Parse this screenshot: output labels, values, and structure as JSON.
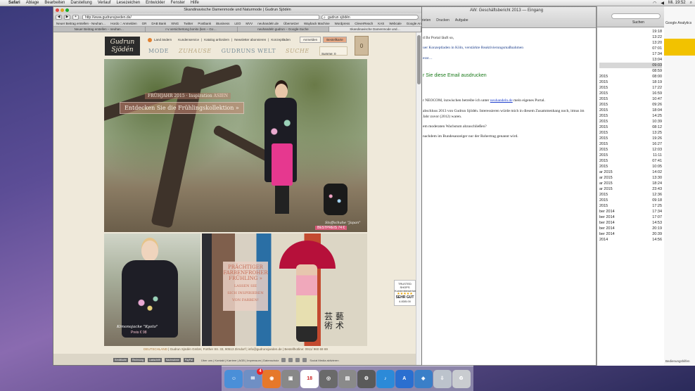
{
  "menubar": {
    "app": "Safari",
    "items": [
      "Ablage",
      "Bearbeiten",
      "Darstellung",
      "Verlauf",
      "Lesezeichen",
      "Entwickler",
      "Fenster",
      "Hilfe"
    ],
    "clock": "Mi. 19:52"
  },
  "mail": {
    "title": "AW: Geschäftsbericht 2013 — Eingang",
    "tools": [
      "Drucken",
      "Aufgabe"
    ],
    "tools_prefix": "erieten",
    "line1": "d Ihr Portal läuft so,",
    "line2": "uer Konzeptladen in Köln, verstärkte Reaktivierungsmaßnahmen",
    "line3": "erat…",
    "print_notice": "r Sie diese Email ausdrucken",
    "p1_pre": "r NEOCOM, inzwischen betreibe ich unter ",
    "p1_link": "neuhandeln.de",
    "p1_post": " mein eigenes Portal.",
    "p2": "abschluss 2013 von Gudrun Sjödén. Interessieren würde mich in diesem Zusammenhang noch, itmus im Jahr zuvor (2012) waren.",
    "p3": "em moderaten Wachstum abzuschließen?",
    "p4": "nachdem im Bundesanzeiger nur der Rohertrag genannt wird."
  },
  "list": {
    "search_label": "Suchen",
    "rows": [
      {
        "d": "",
        "t": "19:18"
      },
      {
        "d": "",
        "t": "13:22"
      },
      {
        "d": "",
        "t": "13:20"
      },
      {
        "d": "",
        "t": "07:01"
      },
      {
        "d": "",
        "t": "17:34"
      },
      {
        "d": "",
        "t": "13:04"
      },
      {
        "d": "",
        "t": "09:03"
      },
      {
        "d": "",
        "t": "08:59"
      },
      {
        "d": "2015",
        "t": "08:00"
      },
      {
        "d": "2015",
        "t": "18:19"
      },
      {
        "d": "2015",
        "t": "17:22"
      },
      {
        "d": "2015",
        "t": "16:59"
      },
      {
        "d": "2015",
        "t": "10:47"
      },
      {
        "d": "2015",
        "t": "09:26"
      },
      {
        "d": "2015",
        "t": "18:04"
      },
      {
        "d": "2015",
        "t": "14:25"
      },
      {
        "d": "2015",
        "t": "10:39"
      },
      {
        "d": "2015",
        "t": "08:12"
      },
      {
        "d": "2015",
        "t": "13:25"
      },
      {
        "d": "2015",
        "t": "19:26"
      },
      {
        "d": "2015",
        "t": "16:27"
      },
      {
        "d": "2015",
        "t": "12:03"
      },
      {
        "d": "2015",
        "t": "11:11"
      },
      {
        "d": "2015",
        "t": "07:41"
      },
      {
        "d": "2015",
        "t": "10:05"
      },
      {
        "d": "ar 2015",
        "t": "14:02"
      },
      {
        "d": "ar 2015",
        "t": "13:30"
      },
      {
        "d": "ar 2015",
        "t": "18:24"
      },
      {
        "d": "ar 2015",
        "t": "23:43"
      },
      {
        "d": "2015",
        "t": "12:36"
      },
      {
        "d": "2015",
        "t": "09:18"
      },
      {
        "d": "2015",
        "t": "17:25"
      },
      {
        "d": "ber 2014",
        "t": "17:34"
      },
      {
        "d": "ber 2014",
        "t": "17:07"
      },
      {
        "d": "ber 2014",
        "t": "14:53"
      },
      {
        "d": "ber 2014",
        "t": "20:19"
      },
      {
        "d": "ber 2014",
        "t": "20:39"
      },
      {
        "d": "2014",
        "t": "14:56"
      }
    ],
    "selected_index": 6
  },
  "ga_strip": {
    "label": "Google Analytics",
    "footer": "Bedienungshilfen"
  },
  "safari": {
    "title": "Skandinavische Damenmode und Naturmode | Gudrun Sjödén",
    "url": "http://www.gudrunsjoeden.de/",
    "search": "gudrun sjödén",
    "bookmarks": [
      "Neuer Beitrag erstellen - Neuhan…",
      "Hordo :: Anmelden",
      "GR",
      "DAB Bank",
      "XING",
      "Twitter",
      "Postbank",
      "iBusiness",
      "LEO",
      "MVV",
      "neuhandeln.de",
      "Übersetzer",
      "Wayback Machine",
      "Wordpress",
      "CleverReach",
      "KAS",
      "Webcale",
      "Google Analytics",
      "ACNITAS"
    ],
    "tabs": [
      "Neuer Beitrag erstellen – neuhan…",
      "r-v versichertong bonito (ken – Go…",
      "neuhandeln gudrun – Google-Suche",
      "Skandinavische Damenmode und…"
    ]
  },
  "site": {
    "logo_l1": "Gudrun",
    "logo_l2": "Sjödén",
    "country": "Land ändern",
    "top_links": [
      "Kundenservice",
      "Katalog anfordern",
      "Newsletter abonnieren",
      "Konzeptläden"
    ],
    "login": "Anmelden",
    "order": "Bestellkarte",
    "nav": [
      "MODE",
      "ZUHAUSE",
      "GUDRUNS WELT",
      "SUCHE"
    ],
    "cart_label": "Summe: 0",
    "cart_count": "0",
    "season": "FRÜHJAHR 2015",
    "season_sub": " · Inspiration ",
    "season_tag": "ASIEN",
    "cta": "Entdecken Sie die Frühlingskollektion »",
    "shoe_label": "Stoffschuhe \"Japan\"",
    "shoe_price": "BESTPREIS 74 €",
    "tile1_label": "Kimonojacke \"Kyoto\"",
    "tile1_price": "Preis € 98",
    "tile2_l1": "PRÄCHTIGER",
    "tile2_l2": "FARBENFROHER",
    "tile2_l3": "FRÜHLING »",
    "tile2_s1": "LASSEN SIE",
    "tile2_s2": "SICH INSPIRIEREN",
    "tile2_s3": "VON FARBEN!",
    "tile2_cjk": "芸 藝 術 术",
    "trusted_title": "TRUSTED SHOPS",
    "trusted_sub": "Kundenbewertung",
    "trusted_grade": "SEHR GUT",
    "trusted_score": "4.83",
    "trusted_score_max": "/5.00",
    "footer_country": "DEUTSCHLAND",
    "footer_addr": " | Gudrun Sjödén GmbH, Fürther Str. 33, 90513 Zirndorf | info@gudrunsjoeden.de | Bestellhotline: 0911/ 960 69 69",
    "footer_links": "Über uns | Kontakt | Karriere | AGB | Impressum | Datenschutz",
    "payments": [
      "Kreditkarte",
      "Rechnung",
      "Lastschrift",
      "Nachnahme",
      "PayPal"
    ],
    "social": "Social Media aktivieren"
  },
  "dock": {
    "items": [
      "Finder",
      "Mail",
      "Firefox",
      "Safari",
      "Calendar",
      "Photos",
      "iTunes",
      "App Store",
      "Xcode",
      "Prefs",
      "Trash"
    ],
    "badge": "4"
  }
}
